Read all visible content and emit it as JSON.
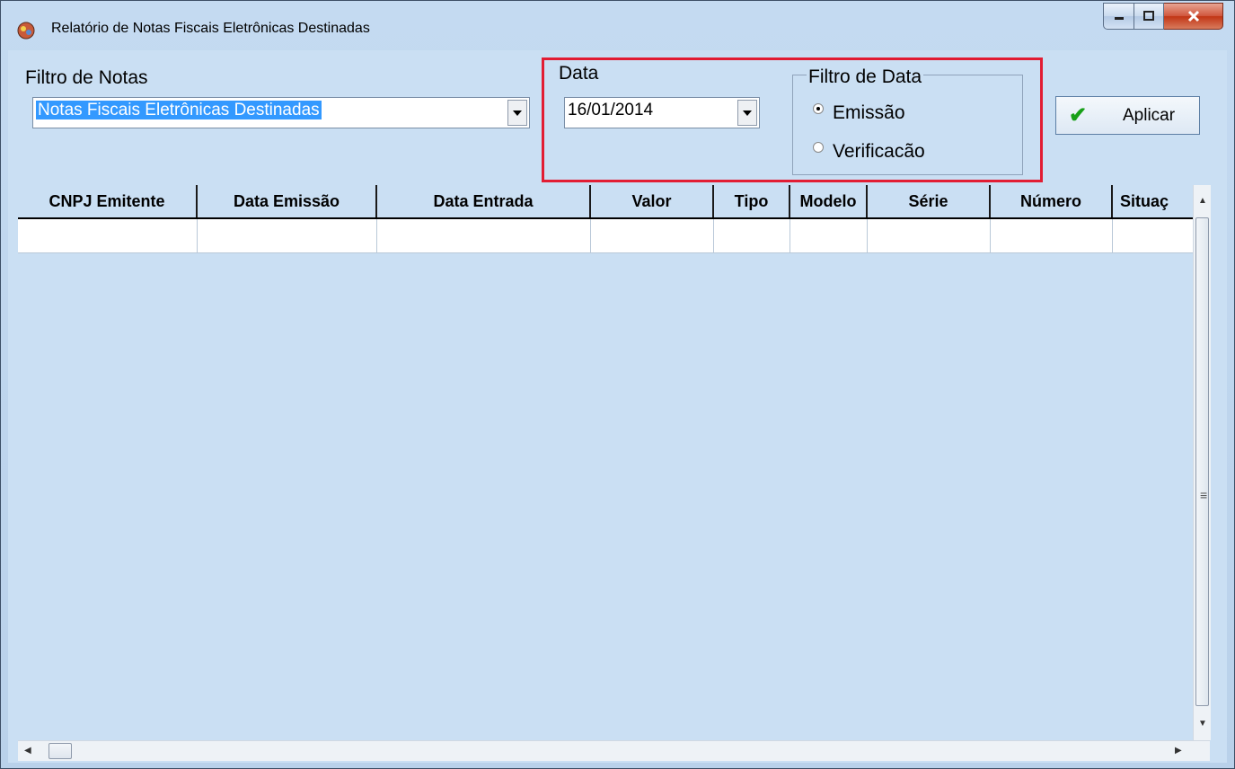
{
  "window": {
    "title": "Relatório de Notas Fiscais Eletrônicas Destinadas"
  },
  "filtro": {
    "label": "Filtro de Notas",
    "value": "Notas Fiscais Eletrônicas Destinadas"
  },
  "data": {
    "label": "Data",
    "value": "16/01/2014"
  },
  "filtro_data": {
    "title": "Filtro de Data",
    "options": [
      {
        "label": "Emissão",
        "selected": true
      },
      {
        "label": "Verificacão",
        "selected": false
      }
    ]
  },
  "aplicar": {
    "label": "Aplicar"
  },
  "grid": {
    "columns": [
      "CNPJ Emitente",
      "Data Emissão",
      "Data Entrada",
      "Valor",
      "Tipo",
      "Modelo",
      "Série",
      "Número",
      "Situaç"
    ]
  },
  "colors": {
    "highlight_border": "#e21d33",
    "background": "#cadff3",
    "selection": "#3399ff"
  }
}
